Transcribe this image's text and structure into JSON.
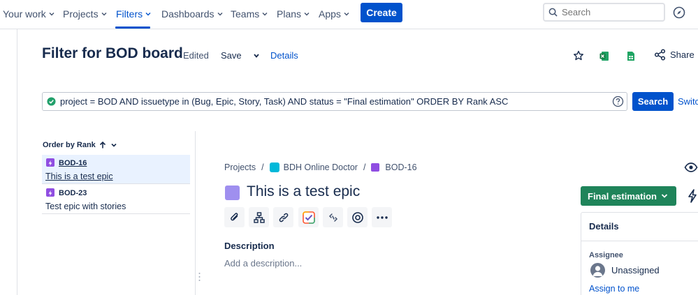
{
  "nav": {
    "items": [
      {
        "label": "Your work"
      },
      {
        "label": "Projects"
      },
      {
        "label": "Filters"
      },
      {
        "label": "Dashboards"
      },
      {
        "label": "Teams"
      },
      {
        "label": "Plans"
      },
      {
        "label": "Apps"
      }
    ],
    "active": "Filters",
    "create_label": "Create",
    "search_placeholder": "Search"
  },
  "header": {
    "title": "Filter for BOD board",
    "edited": "Edited",
    "save": "Save",
    "details": "Details",
    "share": "Share"
  },
  "jql": {
    "query": "project = BOD AND issuetype in (Bug, Epic, Story, Task) AND status = \"Final estimation\" ORDER BY Rank ASC",
    "search_label": "Search",
    "switch_label": "Switch"
  },
  "list": {
    "order_label": "Order by Rank",
    "items": [
      {
        "key": "BOD-16",
        "summary": "This is a test epic",
        "selected": true
      },
      {
        "key": "BOD-23",
        "summary": "Test epic with stories",
        "selected": false
      }
    ]
  },
  "issue": {
    "breadcrumb": {
      "projects": "Projects",
      "project": "BDH Online Doctor",
      "key": "BOD-16"
    },
    "title": "This is a test epic",
    "status": "Final estimation",
    "description_label": "Description",
    "description_placeholder": "Add a description...",
    "details": {
      "heading": "Details",
      "assignee_label": "Assignee",
      "assignee_value": "Unassigned",
      "assign_to_me": "Assign to me"
    }
  },
  "colors": {
    "brand": "#0052CC",
    "status_green": "#1F845A",
    "epic_purple": "#904EE2"
  }
}
